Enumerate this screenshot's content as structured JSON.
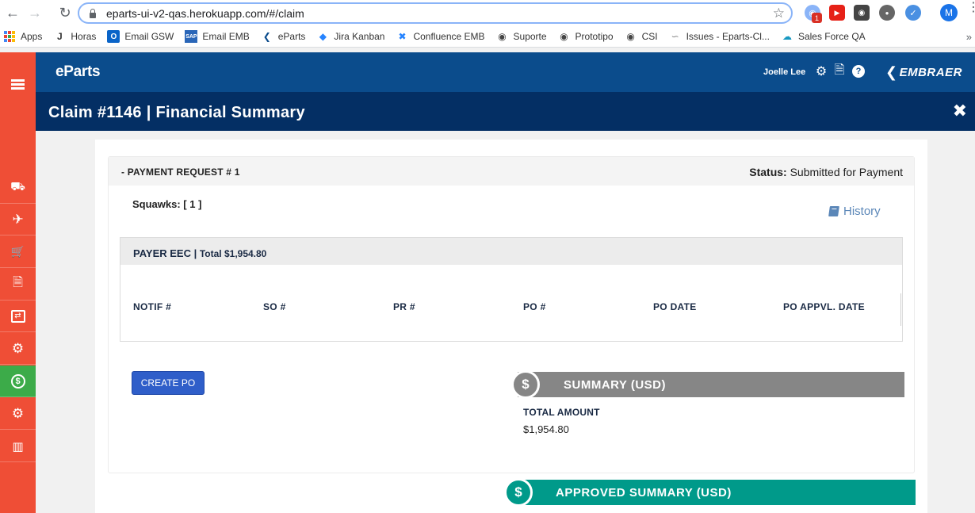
{
  "browser": {
    "url": "eparts-ui-v2-qas.herokuapp.com/#/claim",
    "profile_initial": "M",
    "ext_badge": "1",
    "bookmarks": [
      "Apps",
      "Horas",
      "Email GSW",
      "Email EMB",
      "eParts",
      "Jira Kanban",
      "Confluence EMB",
      "Suporte",
      "Prototipo",
      "CSI",
      "Issues - Eparts-Cl...",
      "Sales Force QA"
    ],
    "more": "»"
  },
  "app": {
    "logo": "eParts",
    "user": "Joelle Lee",
    "brand": "EMBRAER",
    "title": "Claim #1146 | Financial Summary"
  },
  "sidebar": {
    "items": [
      {
        "icon": "truck-icon",
        "glyph": "⛟"
      },
      {
        "icon": "plane-icon",
        "glyph": "✈"
      },
      {
        "icon": "cart-icon",
        "glyph": "🛒"
      },
      {
        "icon": "document-icon",
        "glyph": "🗎"
      },
      {
        "icon": "box-return-icon",
        "glyph": "⇄"
      },
      {
        "icon": "gears-exchange-icon",
        "glyph": "⚙"
      },
      {
        "icon": "dollar-circle-icon",
        "glyph": "$",
        "active": true
      },
      {
        "icon": "gears-icon",
        "glyph": "⚙"
      },
      {
        "icon": "bar-chart-icon",
        "glyph": "▥"
      }
    ]
  },
  "payment": {
    "header": "- PAYMENT REQUEST # 1",
    "status_label": "Status:",
    "status_value": "Submitted for Payment",
    "squawks": "Squawks: [ 1 ]",
    "history": "History",
    "payer": "PAYER EEC",
    "payer_sep": " | ",
    "payer_total": "Total $1,954.80",
    "columns": [
      "NOTIF #",
      "SO #",
      "PR #",
      "PO #",
      "PO DATE",
      "PO APPVL. DATE"
    ],
    "create_po": "CREATE PO"
  },
  "summary": {
    "symbol": "$",
    "title": "SUMMARY (USD)",
    "total_label": "TOTAL AMOUNT",
    "total_value": "$1,954.80"
  },
  "approved": {
    "symbol": "$",
    "title": "APPROVED SUMMARY (USD)"
  },
  "colors": {
    "sidebar": "#ef4e36",
    "appbar": "#0b4c8c",
    "titlebar": "#042f64",
    "active_nav": "#3cab49",
    "summary_bar": "#868686",
    "approved_bar": "#009a8a",
    "button": "#2f5ec9"
  }
}
